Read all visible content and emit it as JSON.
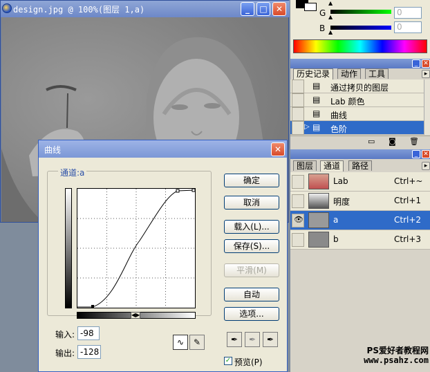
{
  "document": {
    "title": "design.jpg @ 100%(图层 1,a)",
    "buttons": {
      "minimize": "_",
      "maximize": "□",
      "close": "✕"
    }
  },
  "color_panel": {
    "channel_g": "G",
    "channel_b": "B",
    "value_g": "0",
    "value_b": "0"
  },
  "history_panel": {
    "tabs": [
      "历史记录",
      "动作",
      "工具"
    ],
    "items": [
      {
        "label": "通过拷贝的图层",
        "selected": false
      },
      {
        "label": "Lab 颜色",
        "selected": false
      },
      {
        "label": "曲线",
        "selected": false
      },
      {
        "label": "色阶",
        "selected": true
      }
    ]
  },
  "channels_panel": {
    "tabs": [
      "图层",
      "通道",
      "路径"
    ],
    "rows": [
      {
        "name": "Lab",
        "shortcut": "Ctrl+~",
        "selected": false
      },
      {
        "name": "明度",
        "shortcut": "Ctrl+1",
        "selected": false
      },
      {
        "name": "a",
        "shortcut": "Ctrl+2",
        "selected": true
      },
      {
        "name": "b",
        "shortcut": "Ctrl+3",
        "selected": false
      }
    ]
  },
  "curves_dialog": {
    "title": "曲线",
    "channel_label": "通道:a",
    "buttons": {
      "ok": "确定",
      "cancel": "取消",
      "load": "载入(L)...",
      "save": "保存(S)...",
      "smooth": "平滑(M)",
      "auto": "自动",
      "options": "选项..."
    },
    "input_label": "输入:",
    "input_value": "-98",
    "output_label": "输出:",
    "output_value": "-128",
    "preview_label": "预览(P)",
    "preview_checked": true
  },
  "watermark": {
    "line1": "PS爱好者教程网",
    "line2": "www.psahz.com"
  },
  "colors": {
    "accent": "#2f6bc8",
    "titlebar": "#7c97d6",
    "close": "#d84a2a"
  }
}
